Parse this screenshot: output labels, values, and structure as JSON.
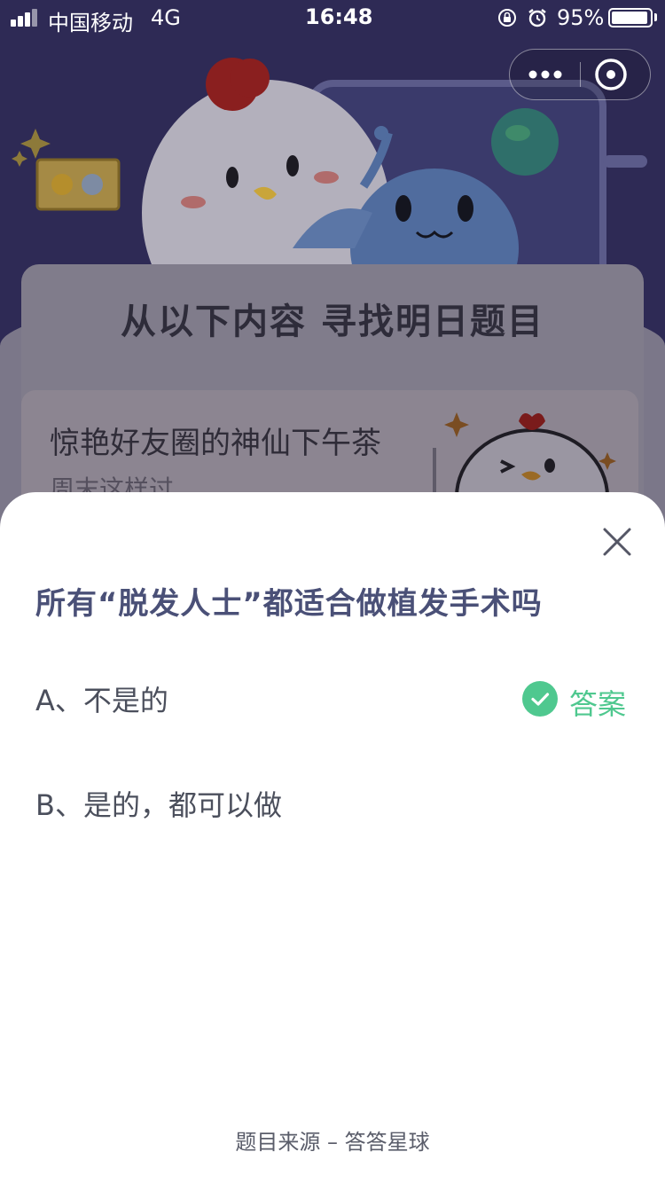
{
  "status_bar": {
    "carrier": "中国移动",
    "network": "4G",
    "time": "16:48",
    "battery_percent": "95%",
    "battery_level": 0.95
  },
  "capsule": {
    "more_icon": "more-dots-icon",
    "close_icon": "close-circle-icon"
  },
  "banner": {
    "title": "从以下内容  寻找明日题目"
  },
  "article": {
    "title": "惊艳好友圈的神仙下午茶",
    "subtitle": "周末这样过"
  },
  "quiz": {
    "question": "所有“脱发人士”都适合做植发手术吗",
    "options": [
      {
        "label": "A、不是的",
        "is_answer": true
      },
      {
        "label": "B、是的，都可以做",
        "is_answer": false
      }
    ],
    "answer_label": "答案",
    "source": "题目来源 – 答答星球",
    "colors": {
      "question": "#4a5077",
      "answer_green": "#4fc88f"
    }
  }
}
